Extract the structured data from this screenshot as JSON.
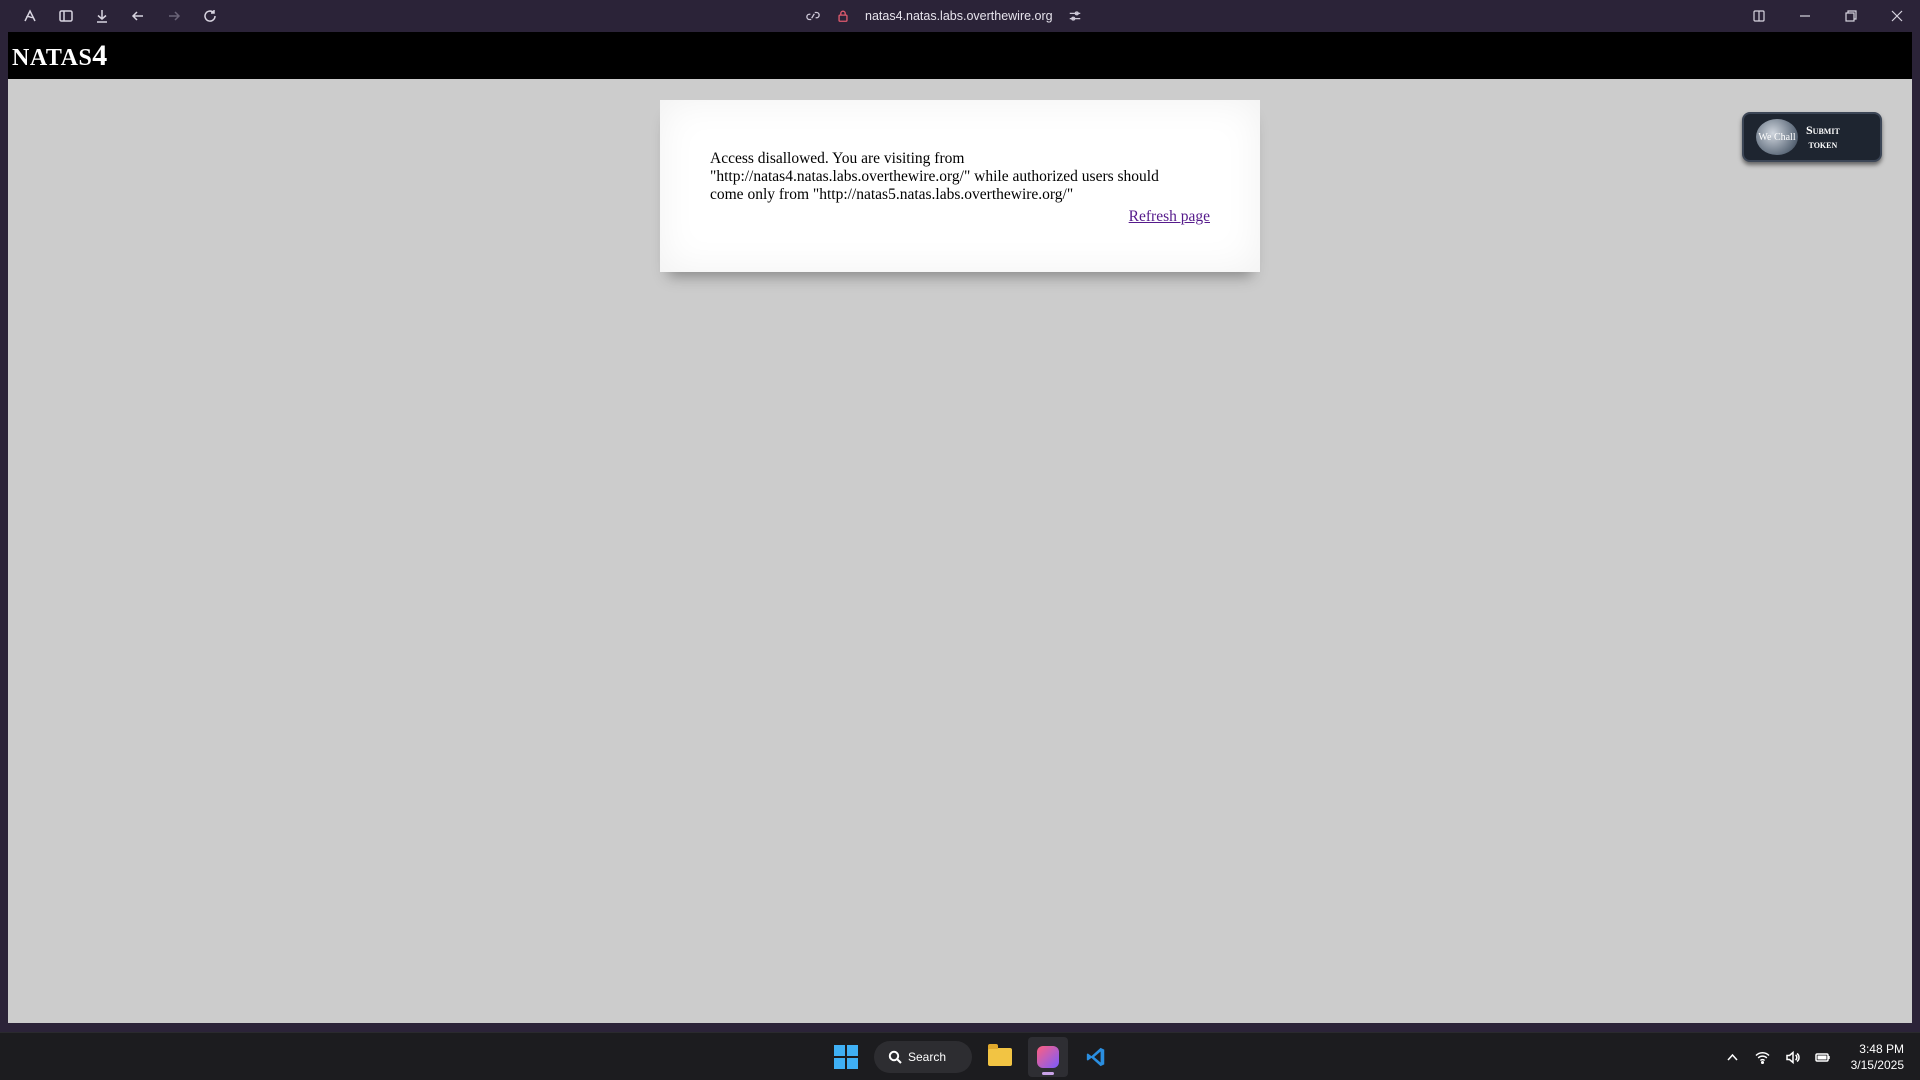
{
  "browser": {
    "url": "natas4.natas.labs.overthewire.org"
  },
  "site": {
    "logo_text": "NATAS",
    "logo_num": "4",
    "message": "Access disallowed. You are visiting from \"http://natas4.natas.labs.overthewire.org/\" while authorized users should come only from \"http://natas5.natas.labs.overthewire.org/\"",
    "refresh_link": "Refresh page",
    "submit_token": {
      "badge_text": "We Chall",
      "line1": "Submit",
      "line2": "token"
    }
  },
  "taskbar": {
    "search_label": "Search",
    "time": "3:48 PM",
    "date": "3/15/2025",
    "windows_logo_color": "#3fb0f5"
  },
  "colors": {
    "chrome_bg": "#2b2338",
    "page_bg": "#cccccc",
    "header_bg": "#000000",
    "link_visited": "#551a8b"
  }
}
